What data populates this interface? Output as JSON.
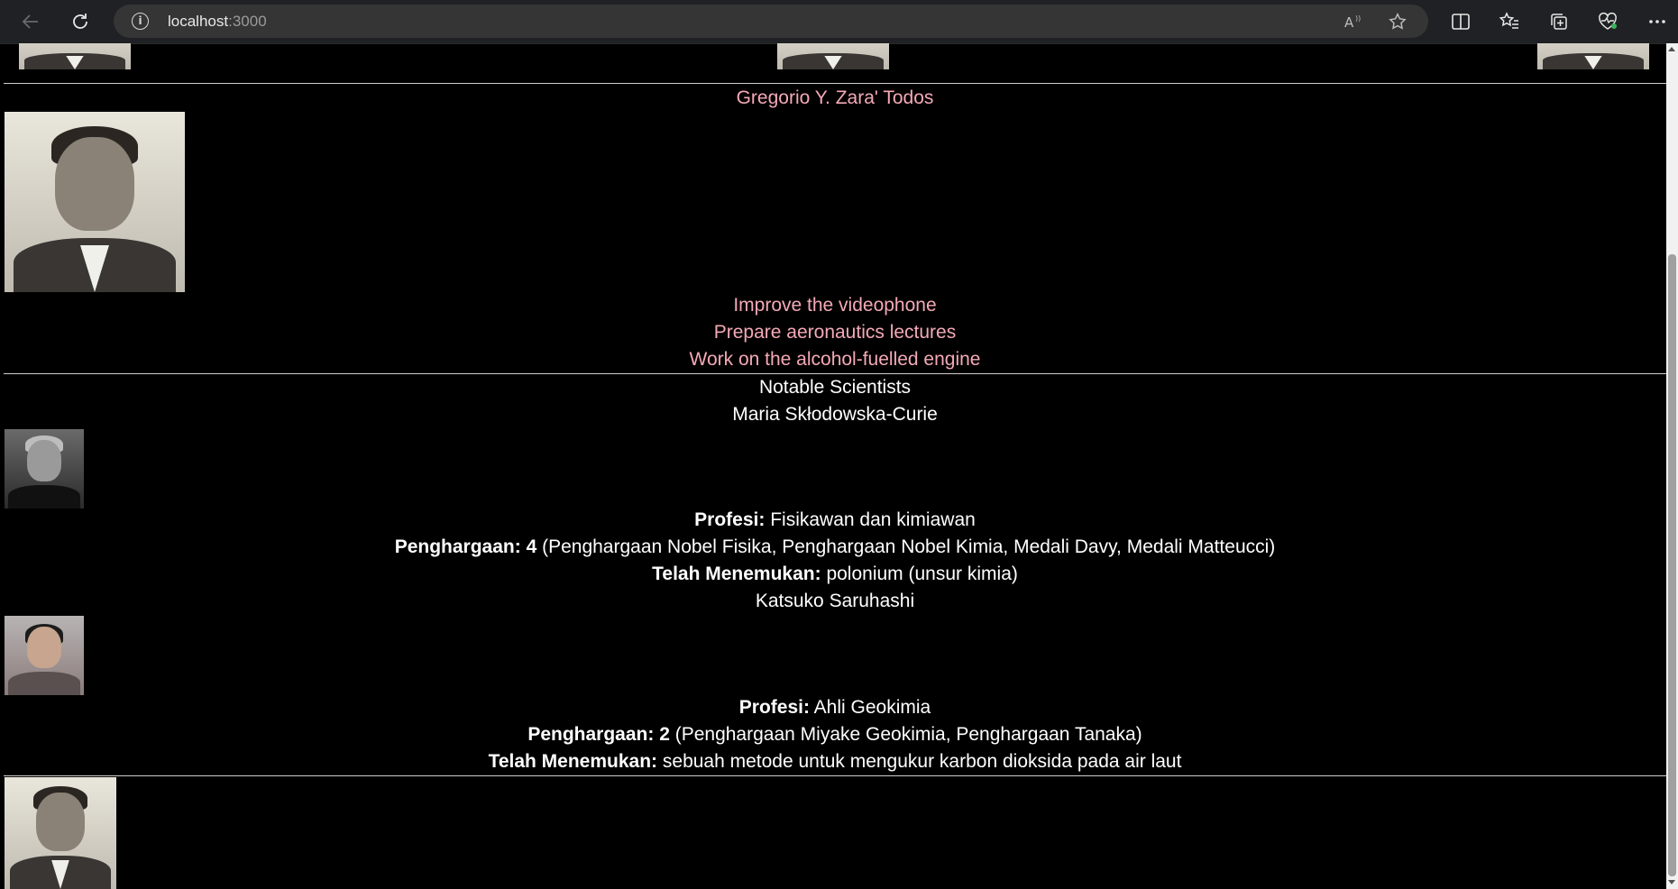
{
  "browser": {
    "url_host": "localhost",
    "url_port": ":3000",
    "icons": {
      "back": "back-arrow-icon",
      "refresh": "refresh-icon",
      "info": "info-icon",
      "read_aloud": "read-aloud-icon",
      "favorite": "star-icon",
      "split": "split-screen-icon",
      "favorites": "favorites-icon",
      "collections": "collections-icon",
      "health": "browser-essentials-icon",
      "more": "more-icon"
    }
  },
  "page": {
    "todo_heading": "Gregorio Y. Zara' Todos",
    "todos": [
      "Improve the videophone",
      "Prepare aeronautics lectures",
      "Work on the alcohol-fuelled engine"
    ],
    "scientists_heading": "Notable Scientists",
    "scientists": [
      {
        "name": "Maria Skłodowska-Curie",
        "profession_label": "Profesi:",
        "profession": "Fisikawan dan kimiawan",
        "awards_label": "Penghargaan: 4",
        "awards": "(Penghargaan Nobel Fisika, Penghargaan Nobel Kimia, Medali Davy, Medali Matteucci)",
        "discovered_label": "Telah Menemukan:",
        "discovered": "polonium (unsur kimia)"
      },
      {
        "name": "Katsuko Saruhashi",
        "profession_label": "Profesi:",
        "profession": "Ahli Geokimia",
        "awards_label": "Penghargaan: 2",
        "awards": "(Penghargaan Miyake Geokimia, Penghargaan Tanaka)",
        "discovered_label": "Telah Menemukan:",
        "discovered": "sebuah metode untuk mengukur karbon dioksida pada air laut"
      }
    ],
    "colors": {
      "background": "#000000",
      "todo_text": "#f4a9b6",
      "text": "#ffffff"
    }
  }
}
